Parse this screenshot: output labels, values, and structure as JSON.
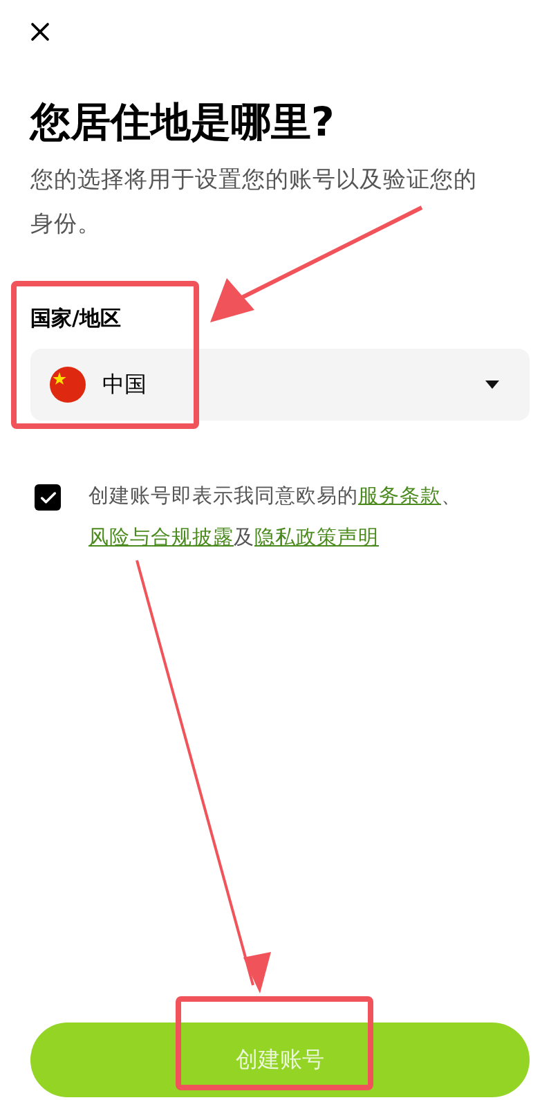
{
  "title": "您居住地是哪里?",
  "subtitle": "您的选择将用于设置您的账号以及验证您的身份。",
  "country_field": {
    "label": "国家/地区",
    "value": "中国"
  },
  "agreement": {
    "checked": true,
    "parts": [
      {
        "kind": "text",
        "text": "创建账号即表示我同意欧易的"
      },
      {
        "kind": "link",
        "text": "服务条款"
      },
      {
        "kind": "text",
        "text": "、"
      },
      {
        "kind": "link",
        "text": "风险与合规披露"
      },
      {
        "kind": "text",
        "text": "及"
      },
      {
        "kind": "link",
        "text": "隐私政策声明"
      }
    ]
  },
  "submit_button": {
    "label": "创建账号"
  }
}
